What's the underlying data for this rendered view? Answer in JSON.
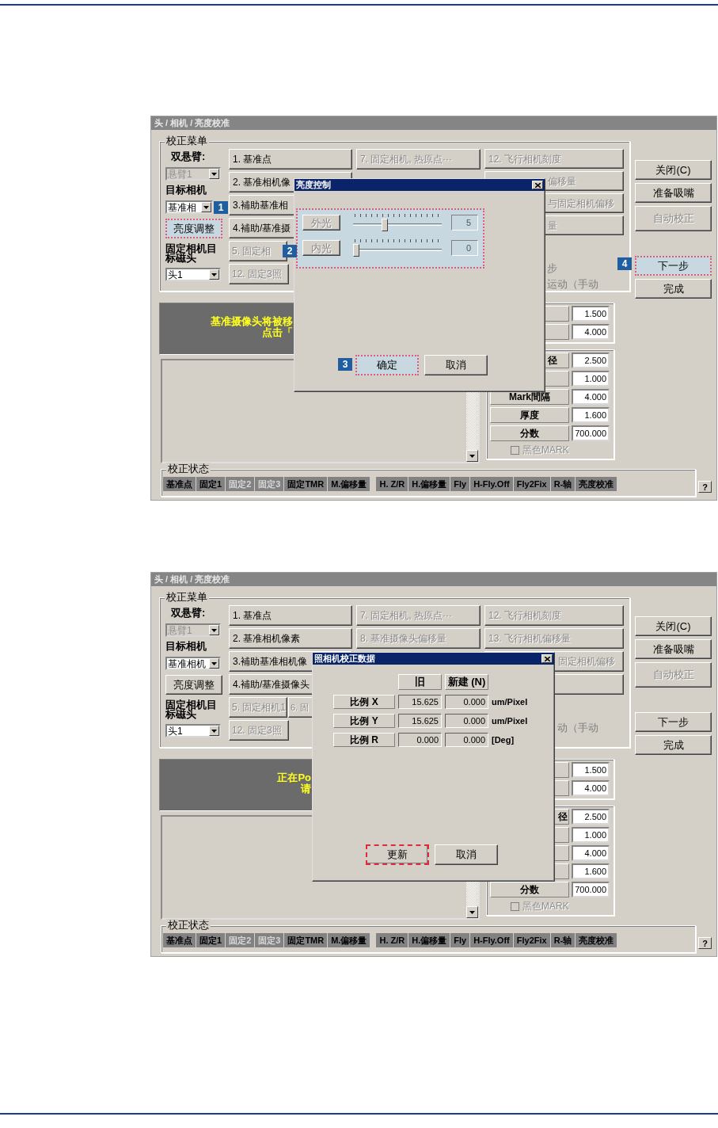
{
  "screens": [
    {
      "window": {
        "title": "头 / 相机 / 亮度校准"
      },
      "menu": {
        "title": "校正菜单",
        "left": [
          {
            "kind": "label",
            "text": "双悬臂:"
          },
          {
            "kind": "combo",
            "value": "悬臂1",
            "disabled": true
          },
          {
            "kind": "label",
            "text": "目标相机"
          },
          {
            "kind": "combo",
            "value": "基准相",
            "disabled": false,
            "callout": "1"
          },
          {
            "kind": "button",
            "text": "亮度调整",
            "highlighted": true
          },
          {
            "kind": "label",
            "text": "固定相机目标磁头"
          },
          {
            "kind": "combo",
            "value": "头1",
            "disabled": false
          }
        ],
        "columns": [
          [
            {
              "kind": "full",
              "text": "1. 基准点",
              "disabled": false
            },
            {
              "kind": "full",
              "text": "2. 基准相机像",
              "disabled": false
            },
            {
              "kind": "full",
              "text": "3.補助基准相",
              "disabled": false
            },
            {
              "kind": "full",
              "text": "4.補助/基准摄",
              "disabled": false
            },
            {
              "kind": "pair",
              "buttons": [
                {
                  "text": "5. 固定相",
                  "disabled": true
                }
              ]
            },
            {
              "kind": "narrow",
              "text": "12. 固定3照",
              "disabled": true
            }
          ],
          [
            {
              "kind": "full",
              "text": "7. 固定相机, 热原点···",
              "disabled": true
            }
          ],
          [
            {
              "kind": "full",
              "text": "12. 飞行相机刻度",
              "disabled": true
            },
            {
              "kind": "full",
              "text": "偏移量",
              "disabled": true,
              "cut_start": true
            },
            {
              "kind": "full",
              "text": "与固定相机偏移",
              "disabled": true,
              "cut_start": true
            },
            {
              "kind": "full",
              "text": "量",
              "disabled": true,
              "cut_start": true
            },
            {
              "kind": "note",
              "text": "步",
              "cut_start": true
            },
            {
              "kind": "note",
              "text": "运动（手动",
              "cut_start": true
            }
          ]
        ]
      },
      "side_buttons": [
        {
          "text": "关闭(C)",
          "disabled": false
        },
        {
          "text": "准备吸嘴",
          "disabled": false
        },
        {
          "text": "自动校正",
          "disabled": true
        },
        {
          "text": "下一步",
          "disabled": false,
          "highlighted": true,
          "callout": "4"
        },
        {
          "text": "完成",
          "disabled": false
        }
      ],
      "message": [
        "基准摄像头将被移",
        "点击「"
      ],
      "param_groups": [
        [
          {
            "value": "1.500"
          },
          {
            "value": "4.000"
          }
        ],
        [
          {
            "label": "径",
            "cut_start": true,
            "value": "2.500"
          },
          {
            "value": "1.000"
          },
          {
            "label": "Mark間隔",
            "value": "4.000"
          },
          {
            "label": "厚度",
            "value": "1.600"
          },
          {
            "label": "分数",
            "value": "700.000"
          }
        ]
      ],
      "mark_checkbox": {
        "text": "黑色MARK",
        "checked": false,
        "disabled": true
      },
      "status": {
        "title": "校正状态",
        "groups": [
          [
            {
              "text": "基准点",
              "disabled": false
            },
            {
              "text": "固定1",
              "disabled": false
            },
            {
              "text": "固定2",
              "disabled": true
            },
            {
              "text": "固定3",
              "disabled": true
            },
            {
              "text": "固定TMR",
              "disabled": false
            },
            {
              "text": "M.偏移量",
              "disabled": false
            }
          ],
          [
            {
              "text": "H. Z/R",
              "disabled": false
            },
            {
              "text": "H.偏移量",
              "disabled": false
            },
            {
              "text": "Fly",
              "disabled": false
            },
            {
              "text": "H-Fly.Off",
              "disabled": false
            },
            {
              "text": "Fly2Fix",
              "disabled": false
            },
            {
              "text": "R-轴",
              "disabled": false
            },
            {
              "text": "亮度校准",
              "disabled": false
            }
          ]
        ],
        "help": "?"
      },
      "dialog": {
        "kind": "sliders",
        "title": "亮度控制",
        "highlighted": true,
        "callout": "2",
        "sliders": [
          {
            "label": "外光",
            "level": 0.35,
            "reading": "5"
          },
          {
            "label": "内光",
            "level": 0,
            "reading": "0"
          }
        ],
        "buttons": [
          {
            "text": "确定",
            "highlighted": true,
            "callout": "3"
          },
          {
            "text": "取消"
          }
        ]
      }
    },
    {
      "window": {
        "title": "头 / 相机 / 亮度校准"
      },
      "menu": {
        "title": "校正菜单",
        "left": [
          {
            "kind": "label",
            "text": "双悬臂:"
          },
          {
            "kind": "combo",
            "value": "悬臂1",
            "disabled": true
          },
          {
            "kind": "label",
            "text": "目标相机"
          },
          {
            "kind": "combo",
            "value": "基准相机",
            "disabled": false
          },
          {
            "kind": "button",
            "text": "亮度调整"
          },
          {
            "kind": "label",
            "text": "固定相机目标磁头"
          },
          {
            "kind": "combo",
            "value": "头1",
            "disabled": false
          }
        ],
        "columns": [
          [
            {
              "kind": "full",
              "text": "1. 基准点",
              "disabled": false
            },
            {
              "kind": "full",
              "text": "2. 基准相机像素",
              "disabled": false
            },
            {
              "kind": "full",
              "text": "3.補助基准相机像",
              "disabled": false
            },
            {
              "kind": "full",
              "text": "4.補助/基准摄像头",
              "disabled": false
            },
            {
              "kind": "pair",
              "buttons": [
                {
                  "text": "5. 固定相机1",
                  "disabled": true
                },
                {
                  "text": "6. 固",
                  "disabled": true
                }
              ]
            },
            {
              "kind": "narrow",
              "text": "12. 固定3照",
              "disabled": true
            }
          ],
          [
            {
              "kind": "full",
              "text": "7. 固定相机, 热原点···",
              "disabled": true
            },
            {
              "kind": "full",
              "text": "8. 基准摄像头偏移量",
              "disabled": true
            }
          ],
          [
            {
              "kind": "full",
              "text": "12. 飞行相机刻度",
              "disabled": true
            },
            {
              "kind": "full",
              "text": "13. 飞行相机偏移量",
              "disabled": true
            },
            {
              "kind": "full",
              "text": "固定相机偏移",
              "disabled": true,
              "cut_start": true
            },
            {
              "kind": "full"
            },
            {
              "kind": "note",
              "text": "动（手动",
              "cut_start": true
            }
          ]
        ]
      },
      "side_buttons": [
        {
          "text": "关闭(C)",
          "disabled": false
        },
        {
          "text": "准备吸嘴",
          "disabled": false
        },
        {
          "text": "自动校正",
          "disabled": true
        },
        {
          "text": "下一步",
          "disabled": false
        },
        {
          "text": "完成",
          "disabled": false
        }
      ],
      "message": [
        "正在Po",
        "请"
      ],
      "param_groups": [
        [
          {
            "value": "1.500"
          },
          {
            "value": "4.000"
          }
        ],
        [
          {
            "label": "径",
            "cut_start": true,
            "value": "2.500"
          },
          {
            "value": "1.000"
          },
          {
            "value": "4.000"
          },
          {
            "value": "1.600"
          },
          {
            "label": "分数",
            "value": "700.000"
          }
        ]
      ],
      "mark_checkbox": {
        "text": "黑色MARK",
        "checked": false,
        "disabled": true
      },
      "status": {
        "title": "校正状态",
        "groups": [
          [
            {
              "text": "基准点",
              "disabled": false
            },
            {
              "text": "固定1",
              "disabled": false
            },
            {
              "text": "固定2",
              "disabled": true
            },
            {
              "text": "固定3",
              "disabled": true
            },
            {
              "text": "固定TMR",
              "disabled": false
            },
            {
              "text": "M.偏移量",
              "disabled": false
            }
          ],
          [
            {
              "text": "H. Z/R",
              "disabled": false
            },
            {
              "text": "H.偏移量",
              "disabled": false
            },
            {
              "text": "Fly",
              "disabled": false
            },
            {
              "text": "H-Fly.Off",
              "disabled": false
            },
            {
              "text": "Fly2Fix",
              "disabled": false
            },
            {
              "text": "R-轴",
              "disabled": false
            },
            {
              "text": "亮度校准",
              "disabled": false
            }
          ]
        ],
        "help": "?"
      },
      "dialog": {
        "kind": "table",
        "title": "照相机校正数据",
        "headers": [
          "旧",
          "新建 (N)"
        ],
        "rows": [
          {
            "label": "比例 X",
            "old": "15.625",
            "new": "0.000",
            "unit": "um/Pixel"
          },
          {
            "label": "比例 Y",
            "old": "15.625",
            "new": "0.000",
            "unit": "um/Pixel"
          },
          {
            "label": "比例 R",
            "old": "0.000",
            "new": "0.000",
            "unit": "[Deg]"
          }
        ],
        "buttons": [
          {
            "text": "更新",
            "highlighted": true
          },
          {
            "text": "取消"
          }
        ]
      }
    }
  ]
}
